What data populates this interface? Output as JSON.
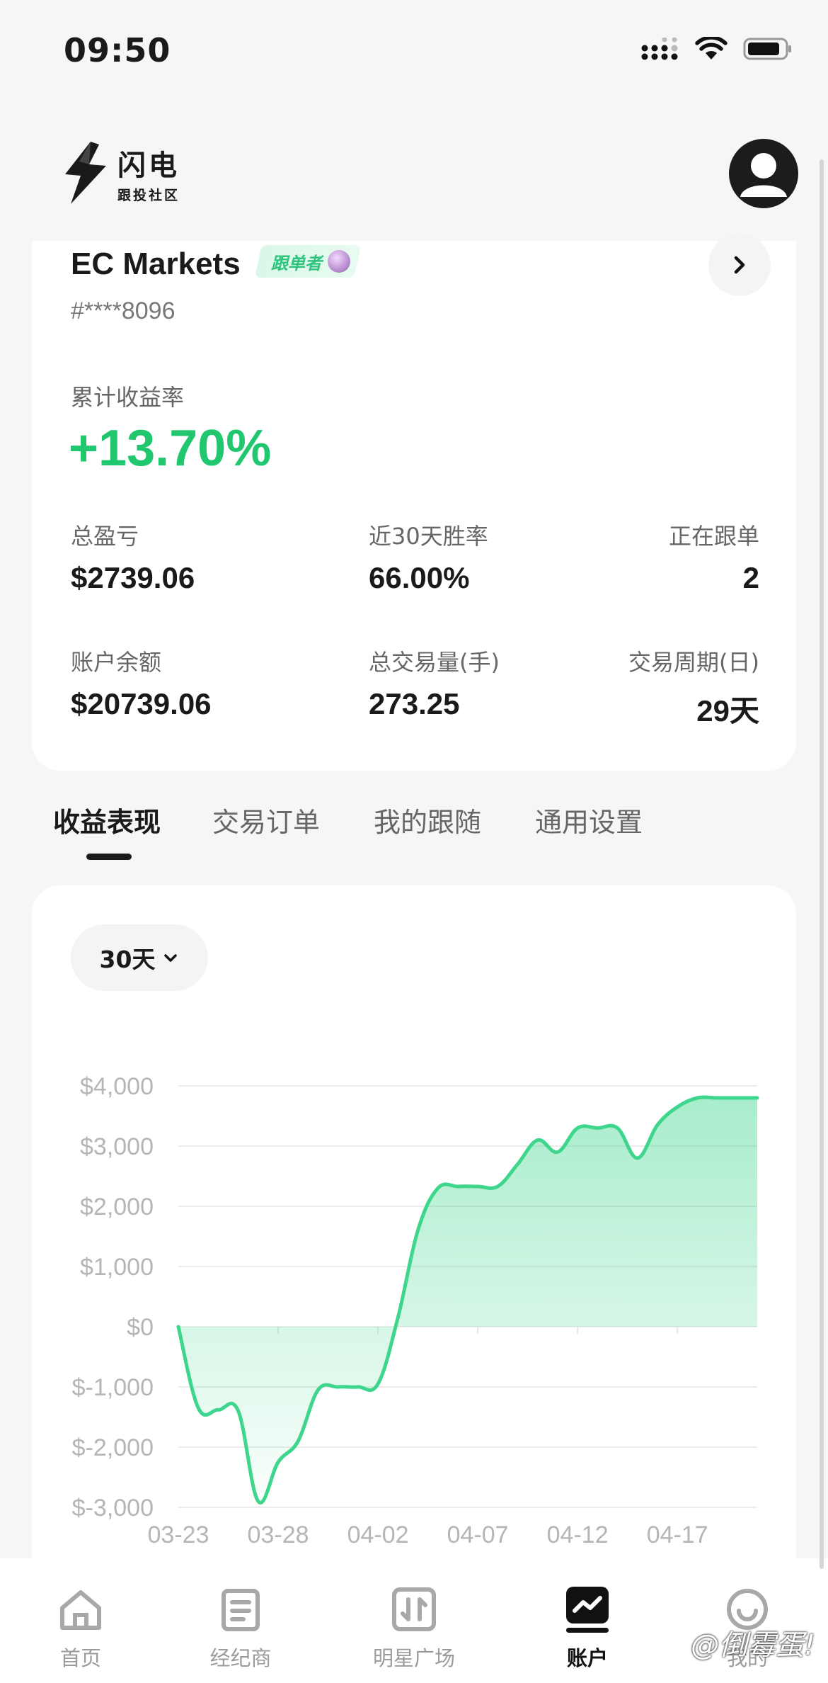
{
  "status_bar": {
    "time": "09:50"
  },
  "header": {
    "logo_main": "闪电",
    "logo_sub": "跟投社区"
  },
  "account": {
    "broker": "EC Markets",
    "tag": "跟单者",
    "account_id": "#****8096",
    "return_label": "累计收益率",
    "return_value": "+13.70%",
    "stats": [
      {
        "label": "总盈亏",
        "value": "$2739.06"
      },
      {
        "label": "近30天胜率",
        "value": "66.00%"
      },
      {
        "label": "正在跟单",
        "value": "2"
      },
      {
        "label": "账户余额",
        "value": "$20739.06"
      },
      {
        "label": "总交易量(手)",
        "value": "273.25"
      },
      {
        "label": "交易周期(日)",
        "value": "29天"
      }
    ]
  },
  "tabs": [
    {
      "label": "收益表现",
      "active": true
    },
    {
      "label": "交易订单",
      "active": false
    },
    {
      "label": "我的跟随",
      "active": false
    },
    {
      "label": "通用设置",
      "active": false
    }
  ],
  "period": {
    "selected": "30天"
  },
  "chart_data": {
    "type": "area",
    "y_ticks": [
      "$4,000",
      "$3,000",
      "$2,000",
      "$1,000",
      "$0",
      "$-1,000",
      "$-2,000",
      "$-3,000"
    ],
    "ylim": [
      -3000,
      4000
    ],
    "x_ticks": [
      "03-23",
      "03-28",
      "04-02",
      "04-07",
      "04-12",
      "04-17"
    ],
    "x_start": "03-23",
    "x_end": "04-21",
    "color": "#3dd68c",
    "series": [
      {
        "x": [
          "03-23",
          "03-24",
          "03-25",
          "03-26",
          "03-27",
          "03-28",
          "03-29",
          "03-30",
          "03-31",
          "04-01",
          "04-02",
          "04-03",
          "04-04",
          "04-05",
          "04-06",
          "04-07",
          "04-08",
          "04-09",
          "04-10",
          "04-11",
          "04-12",
          "04-13",
          "04-14",
          "04-15",
          "04-16",
          "04-17",
          "04-18",
          "04-19",
          "04-20",
          "04-21"
        ],
        "values": [
          0,
          -1350,
          -1380,
          -1400,
          -2900,
          -2250,
          -1900,
          -1050,
          -1000,
          -1000,
          -950,
          150,
          1600,
          2300,
          2330,
          2330,
          2330,
          2700,
          3100,
          2900,
          3300,
          3300,
          3300,
          2800,
          3350,
          3650,
          3800,
          3800,
          3800,
          3800
        ]
      }
    ]
  },
  "nav": [
    {
      "label": "首页",
      "icon": "home-icon",
      "active": false
    },
    {
      "label": "经纪商",
      "icon": "broker-doc-icon",
      "active": false
    },
    {
      "label": "明星广场",
      "icon": "star-square-icon",
      "active": false
    },
    {
      "label": "账户",
      "icon": "account-chart-icon",
      "active": true
    },
    {
      "label": "我的",
      "icon": "profile-icon",
      "active": false
    }
  ],
  "watermark": "@倒霉蛋!"
}
